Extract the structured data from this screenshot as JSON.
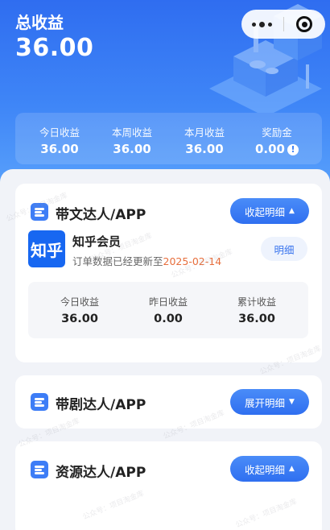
{
  "header": {
    "total_label": "总收益",
    "total_value": "36.00",
    "stats": [
      {
        "label": "今日收益",
        "value": "36.00"
      },
      {
        "label": "本周收益",
        "value": "36.00"
      },
      {
        "label": "本月收益",
        "value": "36.00"
      },
      {
        "label": "奖励金",
        "value": "0.00"
      }
    ],
    "reward_alert_icon": "exclamation-circle-icon"
  },
  "capsule": {
    "more_icon": "more-dots-icon",
    "close_icon": "target-close-icon"
  },
  "cards": [
    {
      "title": "带文达人/APP",
      "toggle_label": "收起明细",
      "toggle_arrow": "▲",
      "app": {
        "logo_text": "知乎",
        "name": "知乎会员",
        "update_prefix": "订单数据已经更新至",
        "update_date": "2025-02-14",
        "detail_label": "明细"
      },
      "stats": [
        {
          "label": "今日收益",
          "value": "36.00"
        },
        {
          "label": "昨日收益",
          "value": "0.00"
        },
        {
          "label": "累计收益",
          "value": "36.00"
        }
      ]
    },
    {
      "title": "带剧达人/APP",
      "toggle_label": "展开明细",
      "toggle_arrow": "▼"
    },
    {
      "title": "资源达人/APP",
      "toggle_label": "收起明细",
      "toggle_arrow": "▲"
    }
  ],
  "watermark_text": "公众号：项目淘金库",
  "colors": {
    "primary": "#3d7df6",
    "date_accent": "#e76e3c",
    "header_top": "#2f6df0"
  }
}
